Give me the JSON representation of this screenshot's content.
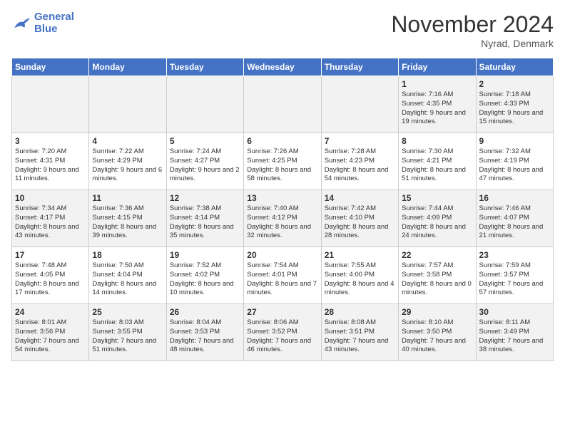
{
  "logo": {
    "line1": "General",
    "line2": "Blue"
  },
  "title": "November 2024",
  "subtitle": "Nyrad, Denmark",
  "days_of_week": [
    "Sunday",
    "Monday",
    "Tuesday",
    "Wednesday",
    "Thursday",
    "Friday",
    "Saturday"
  ],
  "weeks": [
    [
      {
        "day": "",
        "content": ""
      },
      {
        "day": "",
        "content": ""
      },
      {
        "day": "",
        "content": ""
      },
      {
        "day": "",
        "content": ""
      },
      {
        "day": "",
        "content": ""
      },
      {
        "day": "1",
        "content": "Sunrise: 7:16 AM\nSunset: 4:35 PM\nDaylight: 9 hours and 19 minutes."
      },
      {
        "day": "2",
        "content": "Sunrise: 7:18 AM\nSunset: 4:33 PM\nDaylight: 9 hours and 15 minutes."
      }
    ],
    [
      {
        "day": "3",
        "content": "Sunrise: 7:20 AM\nSunset: 4:31 PM\nDaylight: 9 hours and 11 minutes."
      },
      {
        "day": "4",
        "content": "Sunrise: 7:22 AM\nSunset: 4:29 PM\nDaylight: 9 hours and 6 minutes."
      },
      {
        "day": "5",
        "content": "Sunrise: 7:24 AM\nSunset: 4:27 PM\nDaylight: 9 hours and 2 minutes."
      },
      {
        "day": "6",
        "content": "Sunrise: 7:26 AM\nSunset: 4:25 PM\nDaylight: 8 hours and 58 minutes."
      },
      {
        "day": "7",
        "content": "Sunrise: 7:28 AM\nSunset: 4:23 PM\nDaylight: 8 hours and 54 minutes."
      },
      {
        "day": "8",
        "content": "Sunrise: 7:30 AM\nSunset: 4:21 PM\nDaylight: 8 hours and 51 minutes."
      },
      {
        "day": "9",
        "content": "Sunrise: 7:32 AM\nSunset: 4:19 PM\nDaylight: 8 hours and 47 minutes."
      }
    ],
    [
      {
        "day": "10",
        "content": "Sunrise: 7:34 AM\nSunset: 4:17 PM\nDaylight: 8 hours and 43 minutes."
      },
      {
        "day": "11",
        "content": "Sunrise: 7:36 AM\nSunset: 4:15 PM\nDaylight: 8 hours and 39 minutes."
      },
      {
        "day": "12",
        "content": "Sunrise: 7:38 AM\nSunset: 4:14 PM\nDaylight: 8 hours and 35 minutes."
      },
      {
        "day": "13",
        "content": "Sunrise: 7:40 AM\nSunset: 4:12 PM\nDaylight: 8 hours and 32 minutes."
      },
      {
        "day": "14",
        "content": "Sunrise: 7:42 AM\nSunset: 4:10 PM\nDaylight: 8 hours and 28 minutes."
      },
      {
        "day": "15",
        "content": "Sunrise: 7:44 AM\nSunset: 4:09 PM\nDaylight: 8 hours and 24 minutes."
      },
      {
        "day": "16",
        "content": "Sunrise: 7:46 AM\nSunset: 4:07 PM\nDaylight: 8 hours and 21 minutes."
      }
    ],
    [
      {
        "day": "17",
        "content": "Sunrise: 7:48 AM\nSunset: 4:05 PM\nDaylight: 8 hours and 17 minutes."
      },
      {
        "day": "18",
        "content": "Sunrise: 7:50 AM\nSunset: 4:04 PM\nDaylight: 8 hours and 14 minutes."
      },
      {
        "day": "19",
        "content": "Sunrise: 7:52 AM\nSunset: 4:02 PM\nDaylight: 8 hours and 10 minutes."
      },
      {
        "day": "20",
        "content": "Sunrise: 7:54 AM\nSunset: 4:01 PM\nDaylight: 8 hours and 7 minutes."
      },
      {
        "day": "21",
        "content": "Sunrise: 7:55 AM\nSunset: 4:00 PM\nDaylight: 8 hours and 4 minutes."
      },
      {
        "day": "22",
        "content": "Sunrise: 7:57 AM\nSunset: 3:58 PM\nDaylight: 8 hours and 0 minutes."
      },
      {
        "day": "23",
        "content": "Sunrise: 7:59 AM\nSunset: 3:57 PM\nDaylight: 7 hours and 57 minutes."
      }
    ],
    [
      {
        "day": "24",
        "content": "Sunrise: 8:01 AM\nSunset: 3:56 PM\nDaylight: 7 hours and 54 minutes."
      },
      {
        "day": "25",
        "content": "Sunrise: 8:03 AM\nSunset: 3:55 PM\nDaylight: 7 hours and 51 minutes."
      },
      {
        "day": "26",
        "content": "Sunrise: 8:04 AM\nSunset: 3:53 PM\nDaylight: 7 hours and 48 minutes."
      },
      {
        "day": "27",
        "content": "Sunrise: 8:06 AM\nSunset: 3:52 PM\nDaylight: 7 hours and 46 minutes."
      },
      {
        "day": "28",
        "content": "Sunrise: 8:08 AM\nSunset: 3:51 PM\nDaylight: 7 hours and 43 minutes."
      },
      {
        "day": "29",
        "content": "Sunrise: 8:10 AM\nSunset: 3:50 PM\nDaylight: 7 hours and 40 minutes."
      },
      {
        "day": "30",
        "content": "Sunrise: 8:11 AM\nSunset: 3:49 PM\nDaylight: 7 hours and 38 minutes."
      }
    ]
  ]
}
